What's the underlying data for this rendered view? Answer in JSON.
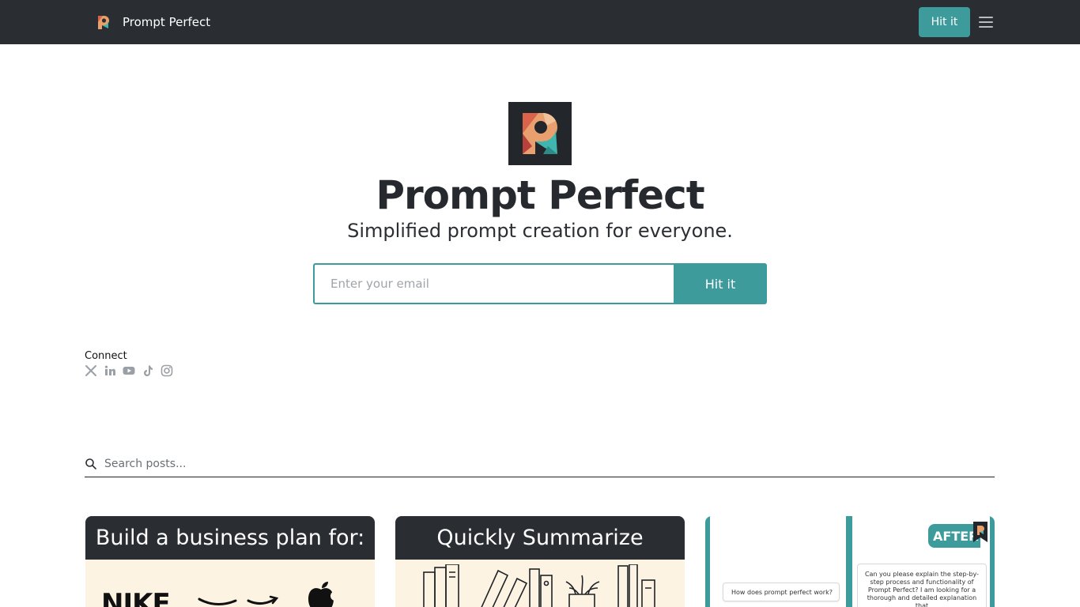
{
  "header": {
    "brand_name": "Prompt Perfect",
    "cta_label": "Hit it",
    "menu_icon": "hamburger-menu-icon"
  },
  "hero": {
    "title": "Prompt Perfect",
    "subtitle": "Simplified prompt creation for everyone.",
    "email_placeholder": "Enter your email",
    "submit_label": "Hit it"
  },
  "connect": {
    "label": "Connect",
    "icons": [
      "x-twitter-icon",
      "linkedin-icon",
      "youtube-icon",
      "tiktok-icon",
      "instagram-icon"
    ]
  },
  "search": {
    "placeholder": "Search posts..."
  },
  "posts": [
    {
      "heading": "Build a business plan for:",
      "brands": [
        "NIKE"
      ]
    },
    {
      "heading": "Quickly Summarize"
    },
    {
      "after_label": "AFTER",
      "question": "How does prompt perfect work?",
      "answer": "Can you please explain the step-by-step process and functionality of Prompt Perfect? I am looking for a thorough and detailed explanation that"
    }
  ],
  "colors": {
    "topbar": "#2a2d31",
    "accent": "#3d9b9b",
    "card_cream": "#fdf3e3"
  }
}
